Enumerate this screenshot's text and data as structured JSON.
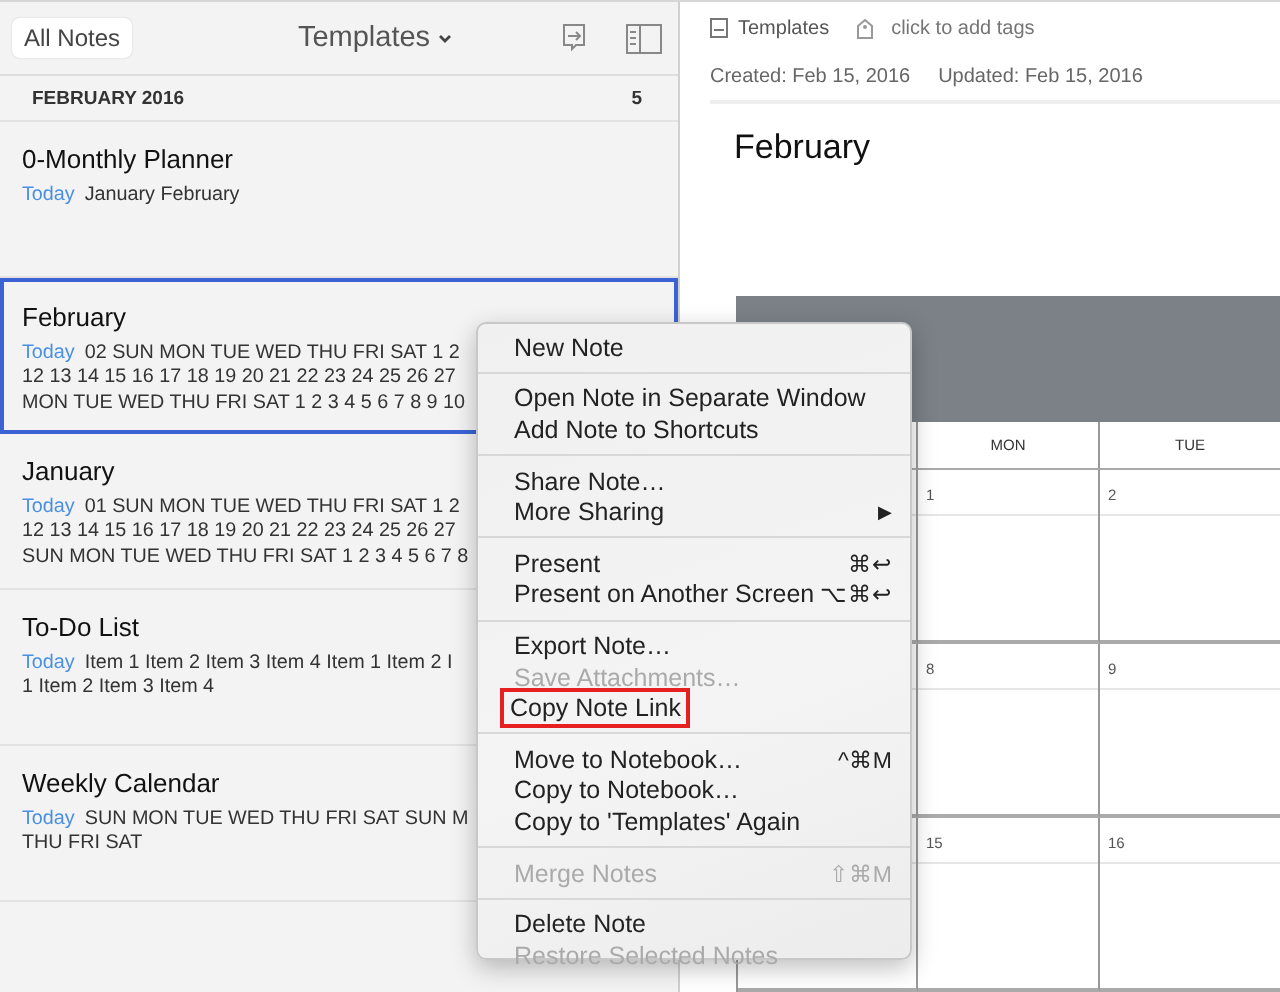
{
  "list_header": {
    "back_button": "All Notes",
    "notebook": "Templates"
  },
  "section": {
    "label": "FEBRUARY 2016",
    "count": "5"
  },
  "notes": [
    {
      "title": "0-Monthly Planner",
      "date": "Today",
      "lines": [
        "January February"
      ],
      "selected": false
    },
    {
      "title": "February",
      "date": "Today",
      "lines": [
        "02 SUN MON TUE WED THU FRI SAT 1 2",
        "12 13 14 15 16 17 18 19 20 21 22 23 24 25 26 27",
        "MON TUE WED THU FRI SAT 1 2 3 4 5 6 7 8 9 10"
      ],
      "selected": true
    },
    {
      "title": "January",
      "date": "Today",
      "lines": [
        "01 SUN MON TUE WED THU FRI SAT 1 2",
        "12 13 14 15 16 17 18 19 20 21 22 23 24 25 26 27",
        "SUN MON TUE WED THU FRI SAT 1 2 3 4 5 6 7 8"
      ],
      "selected": false
    },
    {
      "title": "To-Do List",
      "date": "Today",
      "lines": [
        "Item 1 Item 2 Item 3 Item 4 Item 1 Item 2 I",
        "1 Item 2 Item 3 Item 4"
      ],
      "selected": false
    },
    {
      "title": "Weekly Calendar",
      "date": "Today",
      "lines": [
        "SUN MON TUE WED THU FRI SAT SUN M",
        "THU FRI SAT"
      ],
      "selected": false
    }
  ],
  "note": {
    "notebook": "Templates",
    "tags_placeholder": "click to add tags",
    "created": "Created: Feb 15, 2016",
    "updated": "Updated: Feb 15, 2016",
    "title": "February",
    "calendar": {
      "columns": [
        "",
        "MON",
        "TUE"
      ],
      "rows": [
        [
          "",
          "1",
          "2"
        ],
        [
          "",
          "8",
          "9"
        ],
        [
          "",
          "15",
          "16"
        ]
      ]
    }
  },
  "context_menu": [
    {
      "kind": "item",
      "label": "New Note",
      "disabled": false,
      "outlined": false
    },
    {
      "kind": "separator"
    },
    {
      "kind": "item",
      "label": "Open Note in Separate Window",
      "disabled": false,
      "outlined": false
    },
    {
      "kind": "item",
      "label": "Add Note to Shortcuts",
      "disabled": false,
      "outlined": false
    },
    {
      "kind": "separator"
    },
    {
      "kind": "item",
      "label": "Share Note…",
      "disabled": false,
      "outlined": false
    },
    {
      "kind": "submenu",
      "label": "More Sharing",
      "arrow": "▶",
      "disabled": false,
      "outlined": false
    },
    {
      "kind": "separator"
    },
    {
      "kind": "item",
      "label": "Present",
      "shortcut": "⌘↩",
      "disabled": false,
      "outlined": false
    },
    {
      "kind": "item",
      "label": "Present on Another Screen",
      "shortcut": "⌥⌘↩",
      "disabled": false,
      "outlined": false
    },
    {
      "kind": "separator"
    },
    {
      "kind": "item",
      "label": "Export Note…",
      "disabled": false,
      "outlined": false
    },
    {
      "kind": "item",
      "label": "Save Attachments…",
      "disabled": true,
      "outlined": false
    },
    {
      "kind": "item",
      "label": "Copy Note Link",
      "disabled": false,
      "outlined": true
    },
    {
      "kind": "separator"
    },
    {
      "kind": "item",
      "label": "Move to Notebook…",
      "shortcut": "^⌘M",
      "disabled": false,
      "outlined": false
    },
    {
      "kind": "item",
      "label": "Copy to Notebook…",
      "disabled": false,
      "outlined": false
    },
    {
      "kind": "item",
      "label": "Copy to 'Templates' Again",
      "disabled": false,
      "outlined": false
    },
    {
      "kind": "separator"
    },
    {
      "kind": "item",
      "label": "Merge Notes",
      "shortcut": "⇧⌘M",
      "disabled": true,
      "outlined": false
    },
    {
      "kind": "separator"
    },
    {
      "kind": "item",
      "label": "Delete Note",
      "disabled": false,
      "outlined": false
    },
    {
      "kind": "item",
      "label": "Restore Selected Notes",
      "disabled": true,
      "outlined": false
    }
  ]
}
